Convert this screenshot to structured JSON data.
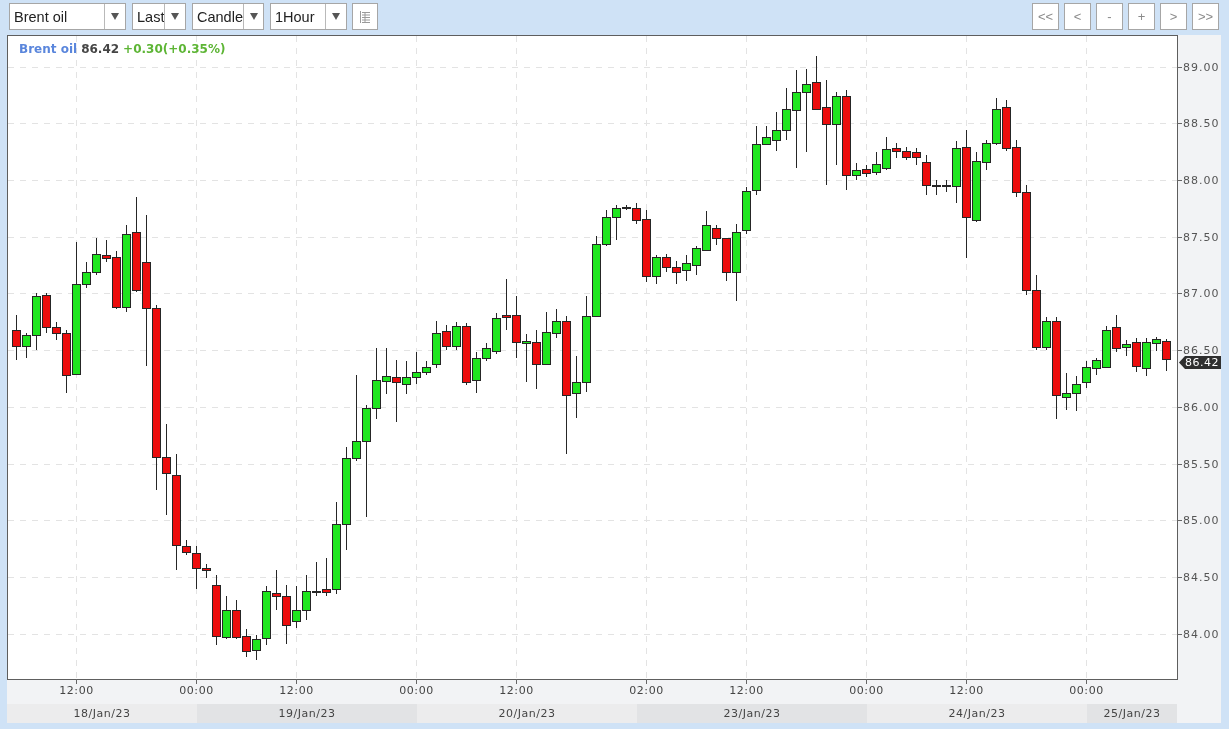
{
  "toolbar": {
    "dropdowns": [
      {
        "value": "Brent oil"
      },
      {
        "value": "Last"
      },
      {
        "value": "Candle"
      },
      {
        "value": "1Hour"
      }
    ],
    "nav_buttons": [
      "<<",
      "<",
      "-",
      "+",
      ">",
      ">>"
    ]
  },
  "chart": {
    "legend": {
      "symbol": "Brent oil",
      "price": "86.42",
      "change": "+0.30(+0.35%)"
    },
    "chart_data": {
      "type": "candlestick",
      "grid": true,
      "categories": [
        null,
        null,
        null,
        null,
        null,
        null,
        "12:00",
        null,
        null,
        null,
        null,
        null,
        null,
        null,
        null,
        null,
        null,
        null,
        "00:00",
        null,
        null,
        null,
        null,
        null,
        null,
        null,
        null,
        null,
        "12:00",
        null,
        null,
        null,
        null,
        null,
        null,
        null,
        null,
        null,
        null,
        null,
        "00:00",
        null,
        null,
        null,
        null,
        null,
        null,
        null,
        null,
        null,
        "12:00",
        null,
        null,
        null,
        null,
        null,
        null,
        null,
        null,
        null,
        null,
        null,
        null,
        "02:00",
        null,
        null,
        null,
        null,
        null,
        null,
        null,
        null,
        null,
        "12:00",
        null,
        null,
        null,
        null,
        null,
        null,
        null,
        null,
        null,
        null,
        null,
        "00:00",
        null,
        null,
        null,
        null,
        null,
        null,
        null,
        null,
        null,
        "12:00",
        null,
        null,
        null,
        null,
        null,
        null,
        null,
        null,
        null,
        null,
        null,
        "00:00",
        null,
        null,
        null,
        null,
        null,
        null,
        null,
        null
      ],
      "ohlc": [
        [
          86.68,
          86.81,
          86.41,
          86.54
        ],
        [
          86.54,
          86.65,
          86.43,
          86.63
        ],
        [
          86.63,
          87.0,
          86.5,
          86.98
        ],
        [
          86.99,
          87.0,
          86.65,
          86.7
        ],
        [
          86.7,
          86.75,
          86.59,
          86.65
        ],
        [
          86.65,
          86.68,
          86.12,
          86.28
        ],
        [
          86.29,
          87.45,
          86.28,
          87.08
        ],
        [
          87.08,
          87.28,
          87.05,
          87.19
        ],
        [
          87.19,
          87.49,
          87.16,
          87.35
        ],
        [
          87.34,
          87.47,
          87.28,
          87.31
        ],
        [
          87.32,
          87.37,
          86.86,
          86.88
        ],
        [
          86.88,
          87.6,
          86.84,
          87.52
        ],
        [
          87.54,
          87.85,
          87.01,
          87.03
        ],
        [
          87.28,
          87.69,
          86.36,
          86.87
        ],
        [
          86.87,
          86.9,
          85.27,
          85.56
        ],
        [
          85.56,
          85.85,
          85.05,
          85.42
        ],
        [
          85.4,
          85.58,
          84.56,
          84.78
        ],
        [
          84.77,
          84.83,
          84.69,
          84.72
        ],
        [
          84.71,
          84.77,
          84.39,
          84.58
        ],
        [
          84.58,
          84.61,
          84.49,
          84.56
        ],
        [
          84.43,
          84.52,
          83.9,
          83.98
        ],
        [
          83.97,
          84.33,
          83.95,
          84.21
        ],
        [
          84.21,
          84.3,
          83.95,
          83.97
        ],
        [
          83.98,
          84.04,
          83.79,
          83.85
        ],
        [
          83.86,
          83.99,
          83.77,
          83.95
        ],
        [
          83.96,
          84.42,
          83.9,
          84.38
        ],
        [
          84.36,
          84.56,
          84.21,
          84.33
        ],
        [
          84.33,
          84.43,
          83.91,
          84.08
        ],
        [
          84.11,
          84.42,
          84.05,
          84.21
        ],
        [
          84.21,
          84.52,
          84.12,
          84.38
        ],
        [
          84.37,
          84.63,
          84.33,
          84.38
        ],
        [
          84.39,
          84.67,
          84.33,
          84.37
        ],
        [
          84.39,
          85.16,
          84.35,
          84.97
        ],
        [
          84.97,
          85.65,
          84.74,
          85.55
        ],
        [
          85.55,
          86.28,
          85.52,
          85.7
        ],
        [
          85.7,
          86.02,
          85.03,
          85.99
        ],
        [
          85.99,
          86.52,
          85.89,
          86.24
        ],
        [
          86.23,
          86.52,
          86.11,
          86.27
        ],
        [
          86.26,
          86.41,
          85.87,
          86.22
        ],
        [
          86.2,
          86.4,
          86.11,
          86.26
        ],
        [
          86.26,
          86.48,
          86.2,
          86.31
        ],
        [
          86.31,
          86.4,
          86.28,
          86.35
        ],
        [
          86.38,
          86.76,
          86.34,
          86.65
        ],
        [
          86.67,
          86.72,
          86.5,
          86.54
        ],
        [
          86.54,
          86.75,
          86.5,
          86.71
        ],
        [
          86.71,
          86.74,
          86.19,
          86.22
        ],
        [
          86.24,
          86.48,
          86.12,
          86.43
        ],
        [
          86.43,
          86.56,
          86.4,
          86.52
        ],
        [
          86.49,
          86.83,
          86.47,
          86.78
        ],
        [
          86.81,
          87.13,
          86.68,
          86.79
        ],
        [
          86.81,
          86.98,
          86.43,
          86.57
        ],
        [
          86.56,
          86.64,
          86.22,
          86.58
        ],
        [
          86.57,
          86.68,
          86.16,
          86.38
        ],
        [
          86.38,
          86.84,
          86.37,
          86.66
        ],
        [
          86.65,
          86.86,
          86.61,
          86.76
        ],
        [
          86.76,
          86.8,
          85.58,
          86.1
        ],
        [
          86.12,
          86.45,
          85.9,
          86.22
        ],
        [
          86.22,
          86.98,
          86.13,
          86.8
        ],
        [
          86.8,
          87.51,
          86.79,
          87.44
        ],
        [
          87.44,
          87.74,
          87.42,
          87.67
        ],
        [
          87.67,
          87.78,
          87.47,
          87.75
        ],
        [
          87.75,
          87.78,
          87.74,
          87.76
        ],
        [
          87.75,
          87.8,
          87.61,
          87.65
        ],
        [
          87.66,
          87.74,
          87.1,
          87.15
        ],
        [
          87.15,
          87.34,
          87.08,
          87.32
        ],
        [
          87.32,
          87.35,
          87.19,
          87.23
        ],
        [
          87.23,
          87.29,
          87.08,
          87.19
        ],
        [
          87.21,
          87.34,
          87.11,
          87.27
        ],
        [
          87.25,
          87.42,
          87.16,
          87.4
        ],
        [
          87.38,
          87.73,
          87.38,
          87.6
        ],
        [
          87.58,
          87.6,
          87.43,
          87.49
        ],
        [
          87.49,
          87.49,
          87.11,
          87.19
        ],
        [
          87.19,
          87.61,
          86.93,
          87.54
        ],
        [
          87.56,
          87.94,
          87.52,
          87.9
        ],
        [
          87.91,
          88.48,
          87.87,
          88.32
        ],
        [
          88.32,
          88.48,
          88.31,
          88.38
        ],
        [
          88.35,
          88.6,
          88.26,
          88.44
        ],
        [
          88.44,
          88.81,
          88.35,
          88.63
        ],
        [
          88.62,
          88.97,
          88.11,
          88.78
        ],
        [
          88.78,
          88.98,
          88.25,
          88.85
        ],
        [
          88.86,
          89.09,
          88.62,
          88.63
        ],
        [
          88.64,
          88.88,
          87.96,
          88.49
        ],
        [
          88.49,
          88.78,
          88.13,
          88.74
        ],
        [
          88.74,
          88.79,
          87.91,
          88.04
        ],
        [
          88.04,
          88.15,
          88.0,
          88.09
        ],
        [
          88.1,
          88.13,
          88.03,
          88.06
        ],
        [
          88.07,
          88.25,
          88.04,
          88.14
        ],
        [
          88.11,
          88.38,
          88.09,
          88.27
        ],
        [
          88.28,
          88.33,
          88.19,
          88.26
        ],
        [
          88.26,
          88.29,
          88.18,
          88.2
        ],
        [
          88.25,
          88.28,
          88.13,
          88.2
        ],
        [
          88.16,
          88.22,
          87.87,
          87.96
        ],
        [
          87.95,
          88.0,
          87.87,
          87.96
        ],
        [
          87.95,
          88.0,
          87.89,
          87.96
        ],
        [
          87.95,
          88.34,
          87.8,
          88.28
        ],
        [
          88.29,
          88.44,
          87.31,
          87.67
        ],
        [
          87.65,
          88.25,
          87.63,
          88.17
        ],
        [
          88.16,
          88.35,
          88.09,
          88.33
        ],
        [
          88.33,
          88.72,
          88.31,
          88.63
        ],
        [
          88.64,
          88.71,
          88.26,
          88.28
        ],
        [
          88.29,
          88.35,
          87.85,
          87.89
        ],
        [
          87.89,
          87.96,
          86.99,
          87.03
        ],
        [
          87.03,
          87.16,
          86.5,
          86.53
        ],
        [
          86.53,
          86.79,
          86.5,
          86.76
        ],
        [
          86.76,
          86.79,
          85.89,
          86.1
        ],
        [
          86.09,
          86.3,
          85.97,
          86.12
        ],
        [
          86.12,
          86.27,
          85.96,
          86.2
        ],
        [
          86.22,
          86.4,
          86.17,
          86.35
        ],
        [
          86.34,
          86.43,
          86.28,
          86.41
        ],
        [
          86.35,
          86.71,
          86.34,
          86.68
        ],
        [
          86.7,
          86.81,
          86.48,
          86.52
        ],
        [
          86.53,
          86.59,
          86.45,
          86.55
        ],
        [
          86.57,
          86.61,
          86.31,
          86.36
        ],
        [
          86.34,
          86.61,
          86.27,
          86.57
        ],
        [
          86.56,
          86.62,
          86.49,
          86.6
        ],
        [
          86.58,
          86.6,
          86.32,
          86.42
        ]
      ],
      "ylim": [
        83.6,
        89.27
      ],
      "yticks": [
        {
          "value": 89,
          "label": "89.00"
        },
        {
          "value": 88.5,
          "label": "88.50"
        },
        {
          "value": 88,
          "label": "88.00"
        },
        {
          "value": 87.5,
          "label": "87.50"
        },
        {
          "value": 87,
          "label": "87.00"
        },
        {
          "value": 86.5,
          "label": "86.50"
        },
        {
          "value": 86,
          "label": "86.00"
        },
        {
          "value": 85.5,
          "label": "85.50"
        },
        {
          "value": 85,
          "label": "85.00"
        },
        {
          "value": 84.5,
          "label": "84.50"
        },
        {
          "value": 84,
          "label": "84.00"
        }
      ]
    },
    "price_tag": "86.42",
    "date_labels": [
      "18/Jan/23",
      "19/Jan/23",
      "20/Jan/23",
      "23/Jan/23",
      "24/Jan/23",
      "25/Jan/23"
    ]
  }
}
